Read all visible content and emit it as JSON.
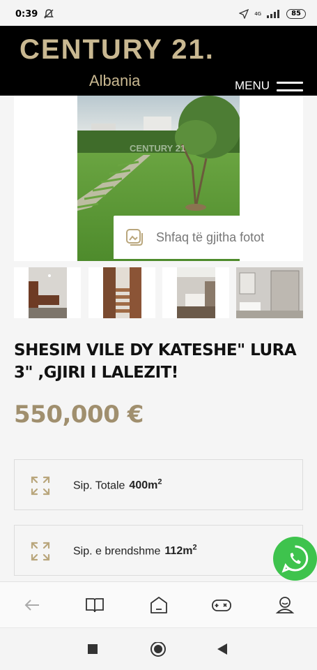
{
  "status_bar": {
    "time": "0:39",
    "network": "4G",
    "battery": "85"
  },
  "header": {
    "brand": "CENTURY 21.",
    "brand_sub": "Albania",
    "menu_label": "MENU"
  },
  "gallery": {
    "show_all_label": "Shfaq të gjitha fotot",
    "watermark": "CENTURY 21"
  },
  "listing": {
    "title": "SHESIM VILE DY KATESHE\" LURA 3\" ,GJIRI I LALEZIT!",
    "price": "550,000 €"
  },
  "specs": [
    {
      "label": "Sip. Totale",
      "value": "400m",
      "unit_sup": "2",
      "icon": "expand-arrows-icon"
    },
    {
      "label": "Sip. e brendshme",
      "value": "112m",
      "unit_sup": "2",
      "icon": "expand-arrows-icon"
    }
  ],
  "bottom_nav": [
    "back-arrow-icon",
    "book-icon",
    "home-icon",
    "gamepad-icon",
    "profile-icon"
  ],
  "colors": {
    "brand_gold": "#c9b891",
    "price_gold": "#a08f6e",
    "whatsapp_green": "#3ec34d",
    "header_bg": "#000000"
  }
}
